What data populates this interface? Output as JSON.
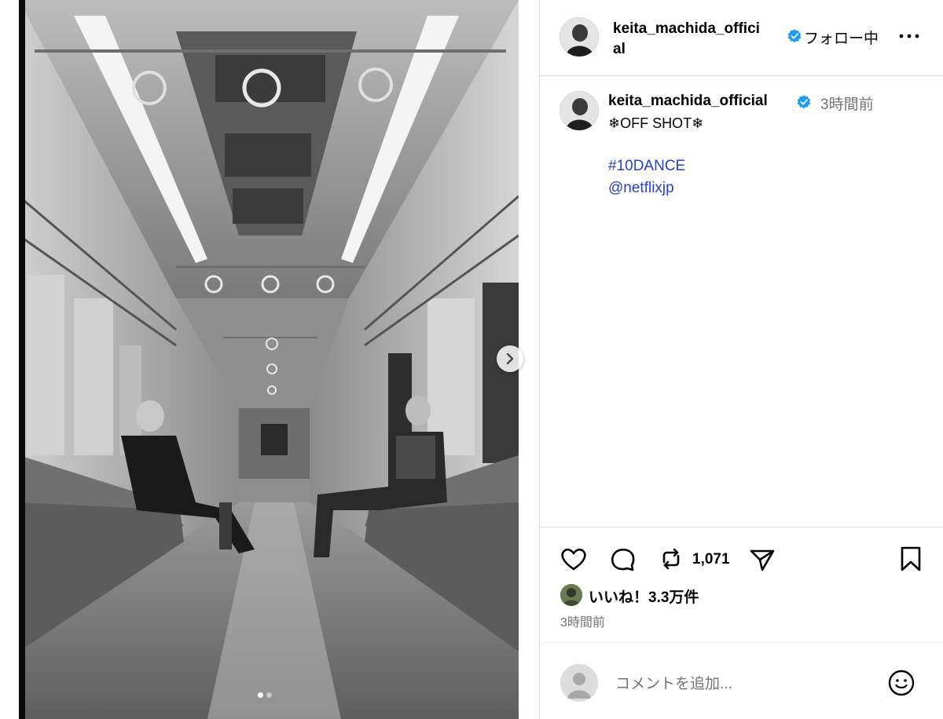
{
  "post": {
    "username": "keita_machida_official",
    "username_wrapped_line1": "keita_machida_offici",
    "username_wrapped_line2": "al",
    "follow_label": "フォロー中",
    "more_icon": "more-horizontal-icon"
  },
  "caption": {
    "username": "keita_machida_official",
    "time_ago": "3時間前",
    "line1": "❄OFF SHOT❄",
    "hashtag": "#10DANCE",
    "mention": "@netflixjp"
  },
  "actions": {
    "like_icon": "heart-icon",
    "comment_icon": "comment-bubble-icon",
    "repost_icon": "repost-icon",
    "repost_count": "1,071",
    "share_icon": "send-icon",
    "save_icon": "bookmark-icon"
  },
  "likes": {
    "text": "いいね！3.3万件"
  },
  "timestamp": "3時間前",
  "comment_box": {
    "placeholder": "コメントを追加...",
    "emoji_icon": "emoji-smile-icon"
  },
  "carousel": {
    "current_index": 1,
    "total": 2
  },
  "colors": {
    "link": "#2540c9",
    "verified": "#1d9bf0",
    "muted": "#737373",
    "divider": "#dbdbdb"
  }
}
